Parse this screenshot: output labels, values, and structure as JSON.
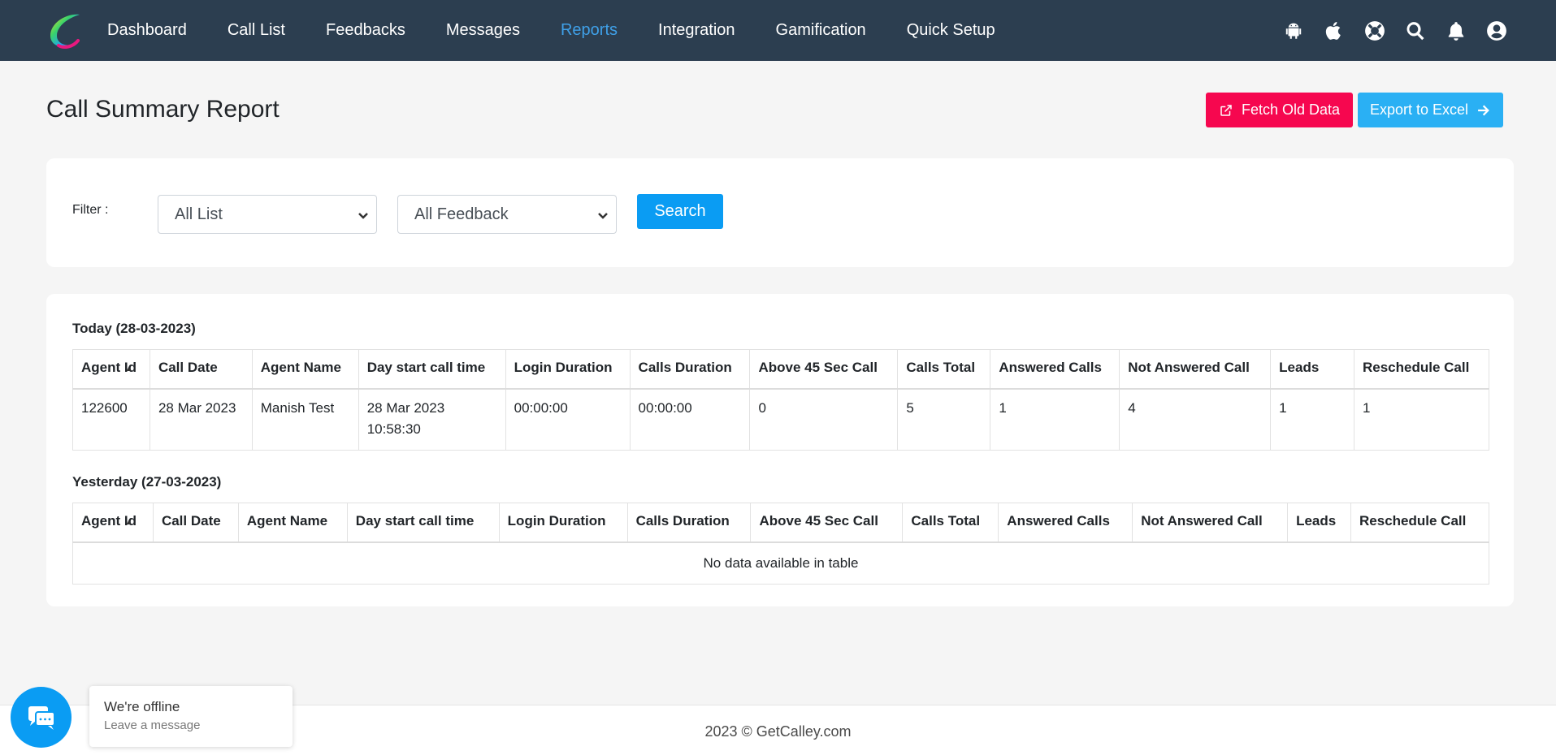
{
  "nav": {
    "items": [
      {
        "label": "Dashboard",
        "active": false
      },
      {
        "label": "Call List",
        "active": false
      },
      {
        "label": "Feedbacks",
        "active": false
      },
      {
        "label": "Messages",
        "active": false
      },
      {
        "label": "Reports",
        "active": true
      },
      {
        "label": "Integration",
        "active": false
      },
      {
        "label": "Gamification",
        "active": false
      },
      {
        "label": "Quick Setup",
        "active": false
      }
    ],
    "icons": [
      "android-icon",
      "apple-icon",
      "support-icon",
      "search-icon",
      "bell-icon",
      "user-icon"
    ],
    "background": "#2c3e50",
    "active_color": "#3fa0e8"
  },
  "header": {
    "title": "Call Summary Report",
    "fetch_button": "Fetch Old Data",
    "export_button": "Export to Excel",
    "fetch_color": "#f6074f",
    "export_color": "#2ab0f4"
  },
  "filter": {
    "label": "Filter :",
    "list_select": "All List",
    "feedback_select": "All Feedback",
    "search_button": "Search"
  },
  "columns": [
    "Agent Id",
    "Call Date",
    "Agent Name",
    "Day start call time",
    "Login Duration",
    "Calls Duration",
    "Above 45 Sec Call",
    "Calls Total",
    "Answered Calls",
    "Not Answered Call",
    "Leads",
    "Reschedule Call"
  ],
  "today": {
    "title": "Today (28-03-2023)",
    "rows": [
      {
        "agent_id": "122600",
        "call_date": "28 Mar 2023",
        "agent_name": "Manish Test",
        "day_start_date": "28 Mar 2023",
        "day_start_time": "10:58:30",
        "login_duration": "00:00:00",
        "calls_duration": "00:00:00",
        "above_45": "0",
        "calls_total": "5",
        "answered": "1",
        "not_answered": "4",
        "leads": "1",
        "reschedule": "1"
      }
    ]
  },
  "yesterday": {
    "title": "Yesterday (27-03-2023)",
    "empty_message": "No data available in table"
  },
  "footer": {
    "text": "2023 © GetCalley.com"
  },
  "chat": {
    "title": "We're offline",
    "subtitle": "Leave a message"
  }
}
